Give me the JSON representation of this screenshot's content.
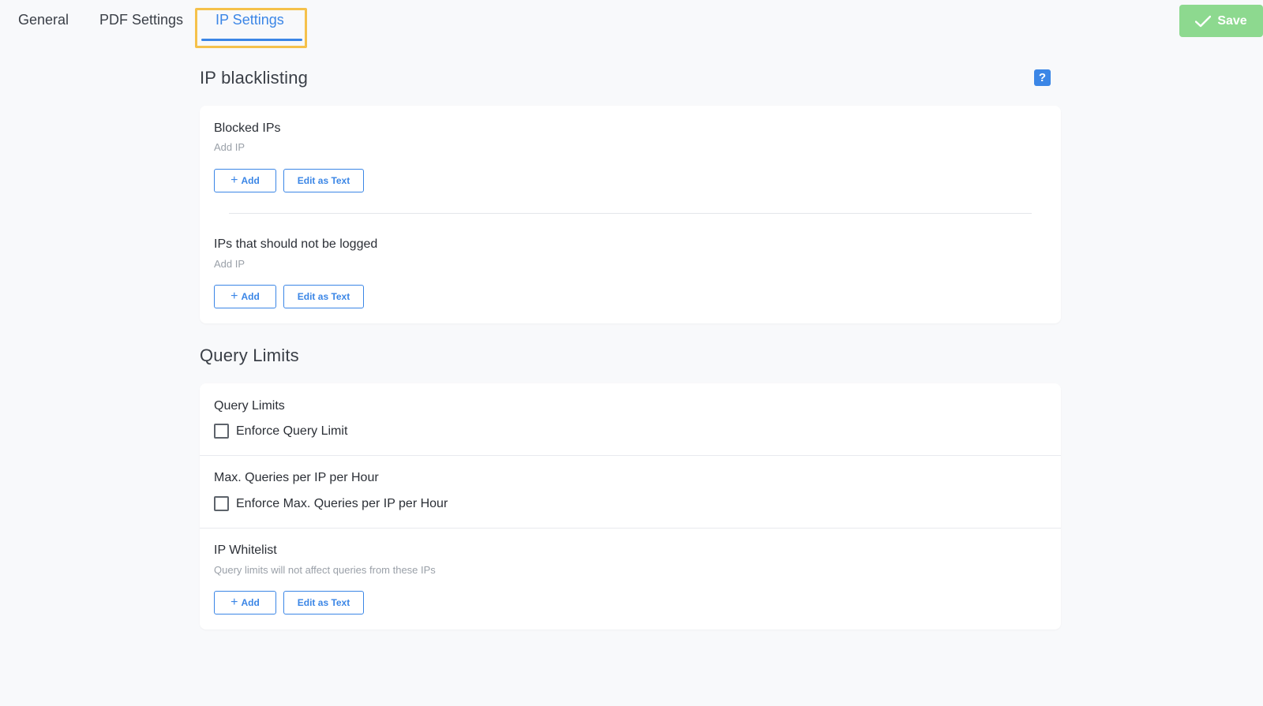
{
  "tabs": [
    {
      "label": "General"
    },
    {
      "label": "PDF Settings"
    },
    {
      "label": "IP Settings"
    }
  ],
  "save_label": "Save",
  "blacklisting": {
    "title": "IP blacklisting",
    "help_symbol": "?",
    "blocked": {
      "title": "Blocked IPs",
      "desc": "Add IP",
      "add_label": "Add",
      "edit_label": "Edit as Text"
    },
    "not_logged": {
      "title": "IPs that should not be logged",
      "desc": "Add IP",
      "add_label": "Add",
      "edit_label": "Edit as Text"
    }
  },
  "query_limits": {
    "title": "Query Limits",
    "limits": {
      "title": "Query Limits",
      "checkbox_label": "Enforce Query Limit"
    },
    "max_queries": {
      "title": "Max. Queries per IP per Hour",
      "checkbox_label": "Enforce Max. Queries per IP per Hour"
    },
    "whitelist": {
      "title": "IP Whitelist",
      "desc": "Query limits will not affect queries from these IPs",
      "add_label": "Add",
      "edit_label": "Edit as Text"
    }
  },
  "colors": {
    "accent": "#3b86e6",
    "save": "#8dd98f",
    "highlight": "#f5c14b"
  }
}
